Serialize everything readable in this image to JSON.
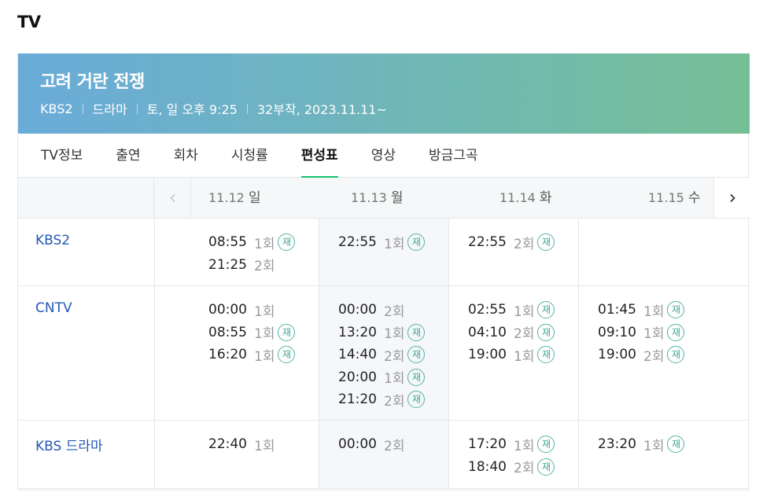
{
  "section_title": "TV",
  "program": {
    "title": "고려 거란 전쟁",
    "meta": [
      "KBS2",
      "드라마",
      "토, 일 오후 9:25",
      "32부작, 2023.11.11~"
    ]
  },
  "tabs": [
    "TV정보",
    "출연",
    "회차",
    "시청률",
    "편성표",
    "영상",
    "방금그곡"
  ],
  "active_tab": "편성표",
  "dates": [
    {
      "date": "11.12",
      "day": "일"
    },
    {
      "date": "11.13",
      "day": "월"
    },
    {
      "date": "11.14",
      "day": "화"
    },
    {
      "date": "11.15",
      "day": "수"
    }
  ],
  "rerun_badge": "재",
  "icons": {
    "prev": "chevron-left-icon",
    "next": "chevron-right-icon"
  },
  "colors": {
    "accent": "#13c468",
    "channel_link": "#2458b8",
    "badge": "#52b3a3"
  },
  "schedule": [
    {
      "channel": "KBS2",
      "days": [
        [
          {
            "time": "08:55",
            "ep": "1회",
            "rerun": true
          },
          {
            "time": "21:25",
            "ep": "2회",
            "rerun": false
          }
        ],
        [
          {
            "time": "22:55",
            "ep": "1회",
            "rerun": true
          }
        ],
        [
          {
            "time": "22:55",
            "ep": "2회",
            "rerun": true
          }
        ],
        []
      ]
    },
    {
      "channel": "CNTV",
      "days": [
        [
          {
            "time": "00:00",
            "ep": "1회",
            "rerun": false
          },
          {
            "time": "08:55",
            "ep": "1회",
            "rerun": true
          },
          {
            "time": "16:20",
            "ep": "1회",
            "rerun": true
          }
        ],
        [
          {
            "time": "00:00",
            "ep": "2회",
            "rerun": false
          },
          {
            "time": "13:20",
            "ep": "1회",
            "rerun": true
          },
          {
            "time": "14:40",
            "ep": "2회",
            "rerun": true
          },
          {
            "time": "20:00",
            "ep": "1회",
            "rerun": true
          },
          {
            "time": "21:20",
            "ep": "2회",
            "rerun": true
          }
        ],
        [
          {
            "time": "02:55",
            "ep": "1회",
            "rerun": true
          },
          {
            "time": "04:10",
            "ep": "2회",
            "rerun": true
          },
          {
            "time": "19:00",
            "ep": "1회",
            "rerun": true
          }
        ],
        [
          {
            "time": "01:45",
            "ep": "1회",
            "rerun": true
          },
          {
            "time": "09:10",
            "ep": "1회",
            "rerun": true
          },
          {
            "time": "19:00",
            "ep": "2회",
            "rerun": true
          }
        ]
      ]
    },
    {
      "channel": "KBS 드라마",
      "days": [
        [
          {
            "time": "22:40",
            "ep": "1회",
            "rerun": false
          }
        ],
        [
          {
            "time": "00:00",
            "ep": "2회",
            "rerun": false
          }
        ],
        [
          {
            "time": "17:20",
            "ep": "1회",
            "rerun": true
          },
          {
            "time": "18:40",
            "ep": "2회",
            "rerun": true
          }
        ],
        [
          {
            "time": "23:20",
            "ep": "1회",
            "rerun": true
          }
        ]
      ]
    }
  ]
}
